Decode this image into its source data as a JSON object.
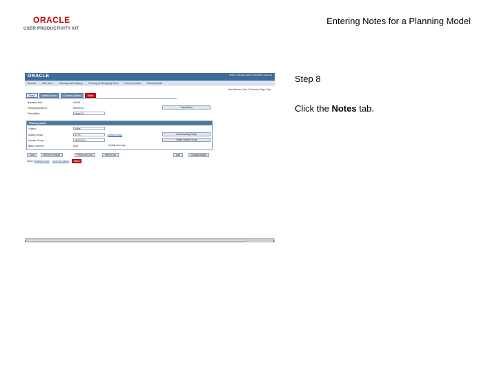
{
  "header": {
    "logo_word": "ORACLE",
    "logo_sub": "USER PRODUCTIVITY KIT",
    "title": "Entering Notes for a Planning Model"
  },
  "step": {
    "label": "Step 8",
    "instruction_prefix": "Click the ",
    "instruction_target": "Notes",
    "instruction_suffix": " tab."
  },
  "screenshot": {
    "brand": "ORACLE",
    "nav_links": "Home | Worklist | Add to Favorites | Sign out",
    "menu_items": [
      "Favorites",
      "Main Menu",
      "Planning and Budgeting",
      "Planning and Budgeting Setup",
      "Planning Models",
      "Planning Model"
    ],
    "util_links": "New Window | Help | Customize Page | http",
    "tabs": [
      "Model",
      "Activity Groups",
      "Currency Options",
      "Notes"
    ],
    "fields": [
      {
        "label": "Business Unit:",
        "value": "US001"
      },
      {
        "label": "Planning Model ID:",
        "value": "MODEL01"
      },
      {
        "label": "Description:",
        "value": "Model 01"
      }
    ],
    "copy_model_button": "Copy Model",
    "group_title": "Planning Model",
    "group_fields": [
      {
        "label": "*Status:",
        "value": "Active"
      },
      {
        "label": "Activity Group:",
        "value": "ACT01"
      },
      {
        "label": "Version Group:",
        "value": "VERSION1"
      },
      {
        "label": "Base Currency:",
        "value": "USD"
      }
    ],
    "activity_link": "Activity Group",
    "create_activity_button": "Create Activity Group",
    "create_version_button": "Create Version Group",
    "checkbox_label": "Multi Currency",
    "bottom_buttons": [
      "Save",
      "Return to Search",
      "Previous in List",
      "Next in List",
      "Add",
      "Update/Display"
    ],
    "bottom_links_prefix": "Model |",
    "bottom_links": [
      "Activity Groups",
      "Currency Options"
    ],
    "notes_link": "Notes"
  }
}
